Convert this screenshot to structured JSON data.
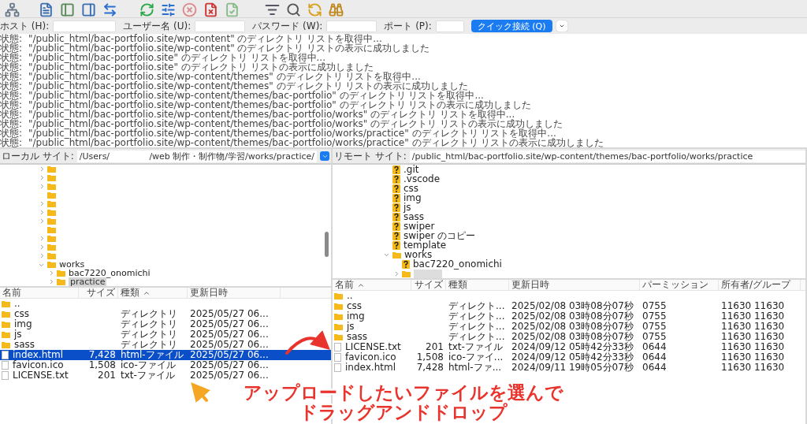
{
  "quickconnect": {
    "fields": [
      {
        "label": "ホスト (H):"
      },
      {
        "label": "ユーザー名 (U):"
      },
      {
        "label": "パスワード (W):"
      },
      {
        "label": "ポート (P):"
      }
    ],
    "button": "クイック接続 (Q)"
  },
  "log": [
    {
      "status": "状態:",
      "message": "\"/public_html/bac-portfolio.site/wp-content\" のディレクトリ リストを取得中..."
    },
    {
      "status": "状態:",
      "message": "\"/public_html/bac-portfolio.site/wp-content\" のディレクトリ リストの表示に成功しました"
    },
    {
      "status": "状態:",
      "message": "\"/public_html/bac-portfolio.site\" のディレクトリ リストを取得中..."
    },
    {
      "status": "状態:",
      "message": "\"/public_html/bac-portfolio.site\" のディレクトリ リストの表示に成功しました"
    },
    {
      "status": "状態:",
      "message": "\"/public_html/bac-portfolio.site/wp-content/themes\" のディレクトリ リストを取得中..."
    },
    {
      "status": "状態:",
      "message": "\"/public_html/bac-portfolio.site/wp-content/themes\" のディレクトリ リストの表示に成功しました"
    },
    {
      "status": "状態:",
      "message": "\"/public_html/bac-portfolio.site/wp-content/themes/bac-portfolio\" のディレクトリ リストを取得中..."
    },
    {
      "status": "状態:",
      "message": "\"/public_html/bac-portfolio.site/wp-content/themes/bac-portfolio\" のディレクトリ リストの表示に成功しました"
    },
    {
      "status": "状態:",
      "message": "\"/public_html/bac-portfolio.site/wp-content/themes/bac-portfolio/works\" のディレクトリ リストを取得中..."
    },
    {
      "status": "状態:",
      "message": "\"/public_html/bac-portfolio.site/wp-content/themes/bac-portfolio/works\" のディレクトリ リストの表示に成功しました"
    },
    {
      "status": "状態:",
      "message": "\"/public_html/bac-portfolio.site/wp-content/themes/bac-portfolio/works/practice\" のディレクトリ リストを取得中..."
    },
    {
      "status": "状態:",
      "message": "\"/public_html/bac-portfolio.site/wp-content/themes/bac-portfolio/works/practice\" のディレクトリ リストの表示に成功しました"
    }
  ],
  "local": {
    "site_label": "ローカル サイト:",
    "path_start": "/Users/",
    "path_end": "/web 制作・制作物/学習/works/practice/",
    "tree": [
      {
        "kind": "folder",
        "expandable": true,
        "expanded": false,
        "selected": false
      },
      {
        "kind": "folder",
        "expandable": true,
        "expanded": false,
        "selected": false
      },
      {
        "kind": "folder",
        "expandable": true,
        "expanded": false,
        "selected": false
      },
      {
        "kind": "folder",
        "expandable": false,
        "selected": false
      },
      {
        "kind": "folder",
        "expandable": true,
        "expanded": false,
        "selected": false
      },
      {
        "kind": "folder",
        "expandable": true,
        "expanded": false,
        "selected": false
      },
      {
        "kind": "folder",
        "expandable": true,
        "expanded": false,
        "selected": false
      },
      {
        "kind": "folder",
        "expandable": false,
        "selected": false
      },
      {
        "kind": "folder",
        "expandable": true,
        "expanded": false,
        "selected": false
      },
      {
        "kind": "folder",
        "expandable": true,
        "expanded": false,
        "selected": false
      },
      {
        "kind": "folder",
        "expandable": true,
        "expanded": false,
        "selected": false
      },
      {
        "kind": "folder",
        "name": "works",
        "expandable": true,
        "expanded": true,
        "selected": false,
        "children": [
          {
            "kind": "folder",
            "name": "bac7220_onomichi",
            "expandable": true,
            "expanded": false,
            "selected": false
          },
          {
            "kind": "folder",
            "name": "practice",
            "expandable": true,
            "expanded": false,
            "selected": true
          }
        ]
      }
    ],
    "columns": [
      {
        "label": "名前",
        "sorted": false
      },
      {
        "label": "サイズ",
        "sorted": false
      },
      {
        "label": "種類",
        "sorted": true
      },
      {
        "label": "更新日時",
        "sorted": false
      }
    ],
    "rows": [
      {
        "kind": "folder",
        "name": "..",
        "selected": false
      },
      {
        "kind": "folder",
        "name": "css",
        "type": "ディレクトリ",
        "date": "2025/05/27 06...",
        "selected": false
      },
      {
        "kind": "folder",
        "name": "img",
        "type": "ディレクトリ",
        "date": "2025/05/27 06...",
        "selected": false
      },
      {
        "kind": "folder",
        "name": "js",
        "type": "ディレクトリ",
        "date": "2025/05/27 06...",
        "selected": false
      },
      {
        "kind": "folder",
        "name": "sass",
        "type": "ディレクトリ",
        "date": "2025/05/27 06...",
        "selected": false
      },
      {
        "kind": "file",
        "name": "index.html",
        "size": "7,428",
        "type": "html-ファイル",
        "date": "2025/05/27 06...",
        "selected": true
      },
      {
        "kind": "file",
        "name": "favicon.ico",
        "size": "1,508",
        "type": "ico-ファイル",
        "date": "2025/05/27 06...",
        "selected": false
      },
      {
        "kind": "file",
        "name": "LICENSE.txt",
        "size": "201",
        "type": "txt-ファイル",
        "date": "2025/05/27 06...",
        "selected": false
      }
    ]
  },
  "remote": {
    "site_label": "リモート サイト:",
    "path": "/public_html/bac-portfolio.site/wp-content/themes/bac-portfolio/works/practice",
    "tree": [
      {
        "kind": "unknown",
        "name": ".git",
        "expandable": false,
        "selected": false
      },
      {
        "kind": "unknown",
        "name": ".vscode",
        "expandable": false,
        "selected": false
      },
      {
        "kind": "unknown",
        "name": "css",
        "expandable": false,
        "selected": false
      },
      {
        "kind": "unknown",
        "name": "img",
        "expandable": false,
        "selected": false
      },
      {
        "kind": "unknown",
        "name": "js",
        "expandable": false,
        "selected": false
      },
      {
        "kind": "unknown",
        "name": "sass",
        "expandable": false,
        "selected": false
      },
      {
        "kind": "unknown",
        "name": "swiper",
        "expandable": false,
        "selected": false
      },
      {
        "kind": "unknown",
        "name": "swiper のコピー",
        "expandable": false,
        "selected": false
      },
      {
        "kind": "unknown",
        "name": "template",
        "expandable": false,
        "selected": false
      },
      {
        "kind": "folder",
        "name": "works",
        "expandable": true,
        "expanded": true,
        "selected": false,
        "children": [
          {
            "kind": "unknown",
            "name": "bac7220_onomichi",
            "expandable": false,
            "selected": false
          },
          {
            "kind": "folder",
            "expandable": true,
            "expanded": false,
            "selected": true
          }
        ]
      }
    ],
    "columns": [
      {
        "label": "名前",
        "sorted": true
      },
      {
        "label": "サイズ",
        "sorted": false
      },
      {
        "label": "種類",
        "sorted": false
      },
      {
        "label": "更新日時",
        "sorted": false
      },
      {
        "label": "パーミッション",
        "sorted": false
      },
      {
        "label": "所有者/グループ",
        "sorted": false
      }
    ],
    "rows": [
      {
        "kind": "folder",
        "name": "..",
        "selected": false
      },
      {
        "kind": "folder",
        "name": "css",
        "type": "ディレクト...",
        "date": "2025/02/08 03時08分07秒",
        "perm": "0755",
        "owner": "11630 11630",
        "selected": false
      },
      {
        "kind": "folder",
        "name": "img",
        "type": "ディレクト...",
        "date": "2025/02/08 03時08分07秒",
        "perm": "0755",
        "owner": "11630 11630",
        "selected": false
      },
      {
        "kind": "folder",
        "name": "js",
        "type": "ディレクト...",
        "date": "2025/02/08 03時08分07秒",
        "perm": "0755",
        "owner": "11630 11630",
        "selected": false
      },
      {
        "kind": "folder",
        "name": "sass",
        "type": "ディレクト...",
        "date": "2025/02/08 03時08分07秒",
        "perm": "0755",
        "owner": "11630 11630",
        "selected": false
      },
      {
        "kind": "file",
        "name": "LICENSE.txt",
        "size": "201",
        "type": "txt-ファイル",
        "date": "2024/09/12 05時42分33秒",
        "perm": "0644",
        "owner": "11630 11630",
        "selected": false
      },
      {
        "kind": "file",
        "name": "favicon.ico",
        "size": "1,508",
        "type": "ico-ファイ...",
        "date": "2024/09/12 05時42分33秒",
        "perm": "0644",
        "owner": "11630 11630",
        "selected": false
      },
      {
        "kind": "file",
        "name": "index.html",
        "size": "7,428",
        "type": "html-ファ...",
        "date": "2024/09/11 19時05分07秒",
        "perm": "0644",
        "owner": "11630 11630",
        "selected": false
      }
    ]
  },
  "annotation": {
    "lines": [
      "アップロードしたいファイルを選んで",
      "ドラッグアンドドロップ"
    ]
  }
}
